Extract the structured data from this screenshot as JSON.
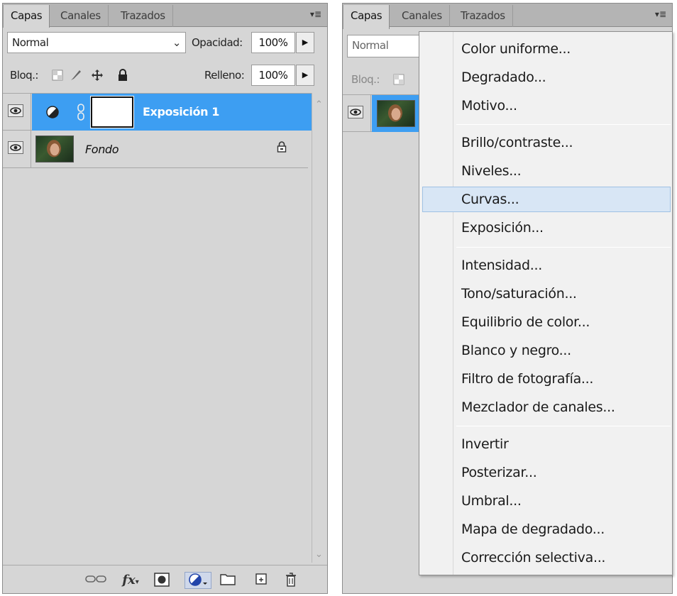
{
  "tabs": [
    "Capas",
    "Canales",
    "Trazados"
  ],
  "panel_menu_icon": "▾≣",
  "blend_mode": "Normal",
  "opacity_label": "Opacidad:",
  "opacity_value": "100%",
  "lock_label": "Bloq.:",
  "fill_label": "Relleno:",
  "fill_value": "100%",
  "layers": [
    {
      "name": "Exposición 1",
      "selected": true
    },
    {
      "name": "Fondo",
      "selected": false
    }
  ],
  "menu": {
    "groups": [
      [
        "Color uniforme...",
        "Degradado...",
        "Motivo..."
      ],
      [
        "Brillo/contraste...",
        "Niveles...",
        "Curvas...",
        "Exposición..."
      ],
      [
        "Intensidad...",
        "Tono/saturación...",
        "Equilibrio de color...",
        "Blanco y negro...",
        "Filtro de fotografía...",
        "Mezclador de canales..."
      ],
      [
        "Invertir",
        "Posterizar...",
        "Umbral...",
        "Mapa de degradado...",
        "Corrección selectiva..."
      ]
    ],
    "highlighted": "Curvas..."
  },
  "colors": {
    "selection_blue": "#3d9ef2",
    "menu_hover": "#d8e6f5",
    "panel_bg": "#d6d6d6"
  }
}
